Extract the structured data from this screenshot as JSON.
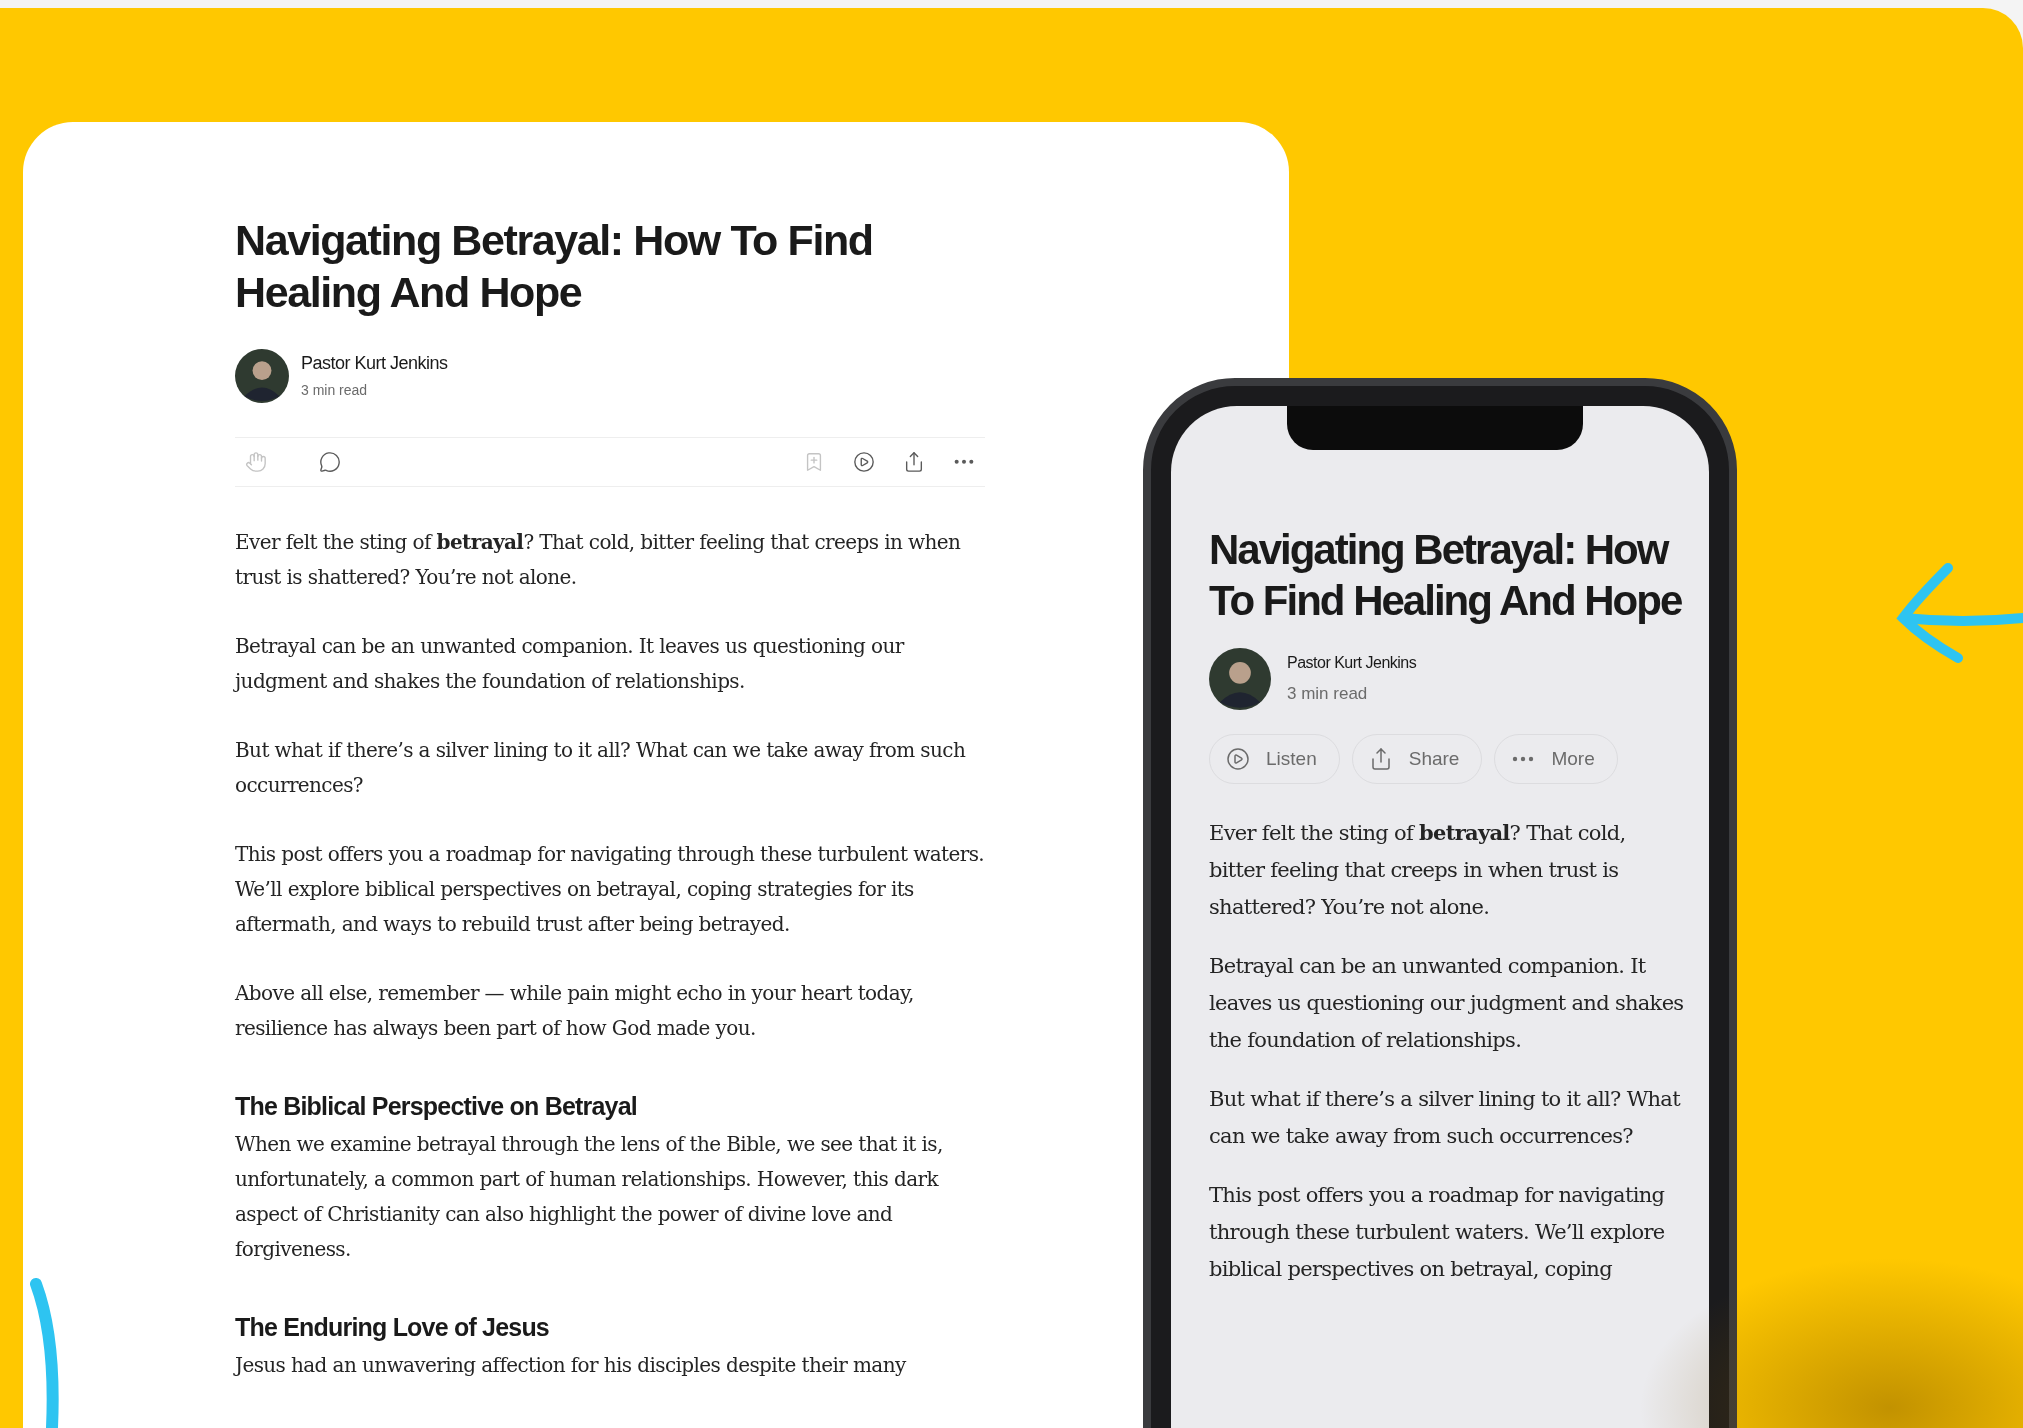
{
  "article": {
    "title": "Navigating Betrayal: How To Find Healing And Hope",
    "author": "Pastor Kurt Jenkins",
    "read_time": "3 min read",
    "toolbar": [
      {
        "kind": "clap",
        "disabled": true
      },
      {
        "kind": "comment",
        "disabled": false
      },
      {
        "kind": "save",
        "disabled": true
      },
      {
        "kind": "listen",
        "disabled": false
      },
      {
        "kind": "share",
        "disabled": false
      },
      {
        "kind": "more",
        "disabled": false
      }
    ],
    "blocks": [
      {
        "kind": "paragraph",
        "text": "Ever felt the sting of **betrayal**? That cold, bitter feeling that creeps in when trust is shattered? You’re not alone."
      },
      {
        "kind": "paragraph",
        "text": "Betrayal can be an unwanted companion. It leaves us questioning our judgment and shakes the foundation of relationships."
      },
      {
        "kind": "paragraph",
        "text": "But what if there’s a silver lining to it all? What can we take away from such occurrences?"
      },
      {
        "kind": "paragraph",
        "text": "This post offers you a roadmap for navigating through these turbulent waters. We’ll explore biblical perspectives on betrayal, coping strategies for its aftermath, and ways to rebuild trust after being betrayed."
      },
      {
        "kind": "paragraph",
        "text": "Above all else, remember — while pain might echo in your heart today, resilience has always been part of how God made you."
      },
      {
        "kind": "heading",
        "text": "The Biblical Perspective on Betrayal"
      },
      {
        "kind": "paragraph",
        "text": "When we examine betrayal through the lens of the Bible, we see that it is, unfortunately, a common part of human relationships. However, this dark aspect of Christianity can also highlight the power of divine love and forgiveness."
      },
      {
        "kind": "heading",
        "text": "The Enduring Love of Jesus"
      },
      {
        "kind": "paragraph",
        "text": "Jesus had an unwavering affection for his disciples despite their many"
      }
    ]
  },
  "phone": {
    "title": "Navigating Betrayal: How To Find Healing And Hope",
    "author": "Pastor Kurt Jenkins",
    "read_time": "3 min read",
    "buttons": [
      {
        "kind": "listen",
        "label": "Listen"
      },
      {
        "kind": "share",
        "label": "Share"
      },
      {
        "kind": "more",
        "label": "More"
      }
    ],
    "blocks": [
      {
        "kind": "paragraph",
        "text": "Ever felt the sting of **betrayal**? That cold, bitter feeling that creeps in when trust is shattered? You’re not alone."
      },
      {
        "kind": "paragraph",
        "text": "Betrayal can be an unwanted companion. It leaves us questioning our judgment and shakes the foundation of relationships."
      },
      {
        "kind": "paragraph",
        "text": "But what if there’s a silver lining to it all? What can we take away from such occurrences?"
      },
      {
        "kind": "paragraph",
        "text": "This post offers you a roadmap for navigating through these turbulent waters. We’ll explore biblical perspectives on betrayal, coping"
      }
    ]
  }
}
